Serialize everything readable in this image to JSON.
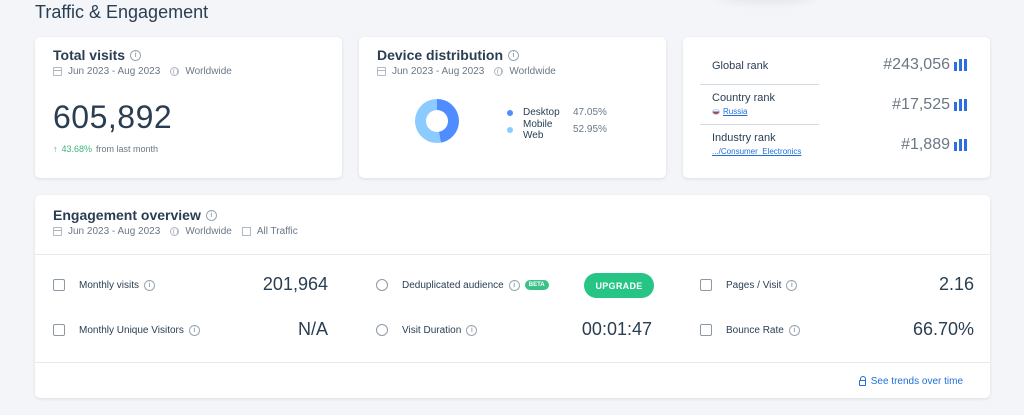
{
  "section_title": "Traffic & Engagement",
  "total_visits": {
    "title": "Total visits",
    "date_range": "Jun 2023 - Aug 2023",
    "region": "Worldwide",
    "value": "605,892",
    "change": "43.68%",
    "change_suffix": "from last month"
  },
  "device_distribution": {
    "title": "Device distribution",
    "date_range": "Jun 2023 - Aug 2023",
    "region": "Worldwide",
    "items": [
      {
        "label": "Desktop",
        "value": "47.05%",
        "percent": 47.05,
        "color": "#4e8cff"
      },
      {
        "label": "Mobile Web",
        "value": "52.95%",
        "percent": 52.95,
        "color": "#8ccbff"
      }
    ]
  },
  "ranks": {
    "global": {
      "label": "Global rank",
      "value": "#243,056"
    },
    "country": {
      "label": "Country rank",
      "sub": "Russia",
      "value": "#17,525"
    },
    "industry": {
      "label": "Industry rank",
      "sub": ".../Consumer_Electronics",
      "value": "#1,889"
    }
  },
  "engagement": {
    "title": "Engagement overview",
    "date_range": "Jun 2023 - Aug 2023",
    "region": "Worldwide",
    "traffic": "All Traffic",
    "monthly_visits": {
      "label": "Monthly visits",
      "value": "201,964"
    },
    "unique_visitors": {
      "label": "Monthly Unique Visitors",
      "value": "N/A"
    },
    "dedup_audience": {
      "label": "Deduplicated audience",
      "badge": "BETA",
      "button": "UPGRADE"
    },
    "visit_duration": {
      "label": "Visit Duration",
      "value": "00:01:47"
    },
    "pages_visit": {
      "label": "Pages / Visit",
      "value": "2.16"
    },
    "bounce_rate": {
      "label": "Bounce Rate",
      "value": "66.70%"
    },
    "trends_link": "See trends over time"
  },
  "colors": {
    "accent": "#2c6fe0",
    "upgrade": "#26c485",
    "positive": "#3eb47e"
  }
}
